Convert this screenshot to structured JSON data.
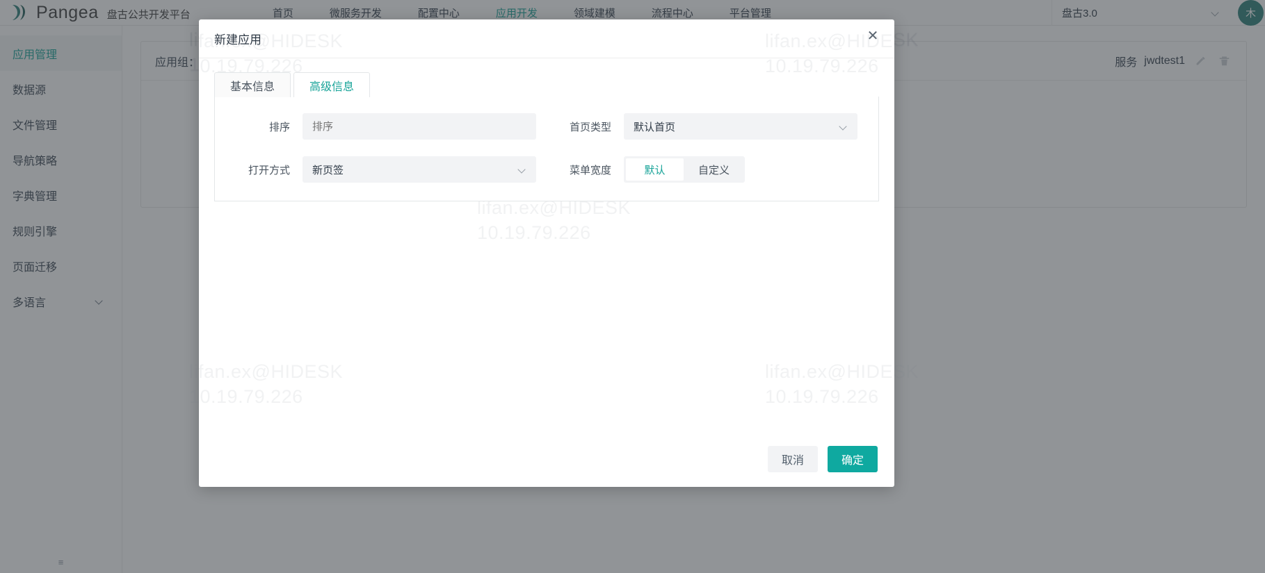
{
  "topbar": {
    "brand_name": "Pangea",
    "brand_subtitle": "盘古公共开发平台",
    "nav": [
      {
        "label": "首页",
        "active": false
      },
      {
        "label": "微服务开发",
        "active": false
      },
      {
        "label": "配置中心",
        "active": false
      },
      {
        "label": "应用开发",
        "active": true
      },
      {
        "label": "领域建模",
        "active": false
      },
      {
        "label": "流程中心",
        "active": false
      },
      {
        "label": "平台管理",
        "active": false
      }
    ],
    "env_select_value": "盘古3.0",
    "avatar_initial": "木"
  },
  "sidebar": {
    "items": [
      {
        "label": "应用管理",
        "active": true,
        "expandable": false
      },
      {
        "label": "数据源",
        "active": false,
        "expandable": false
      },
      {
        "label": "文件管理",
        "active": false,
        "expandable": false
      },
      {
        "label": "导航策略",
        "active": false,
        "expandable": false
      },
      {
        "label": "字典管理",
        "active": false,
        "expandable": false
      },
      {
        "label": "规则引擎",
        "active": false,
        "expandable": false
      },
      {
        "label": "页面迁移",
        "active": false,
        "expandable": false
      },
      {
        "label": "多语言",
        "active": false,
        "expandable": true
      }
    ],
    "collapse_label": "≡"
  },
  "content": {
    "app_group_label": "应用组：",
    "service_label": "服务",
    "service_value": "jwdtest1",
    "edit_icon": "pencil-icon",
    "delete_icon": "trash-icon"
  },
  "modal": {
    "title": "新建应用",
    "close_label": "✕",
    "tabs": [
      {
        "label": "基本信息",
        "active": false
      },
      {
        "label": "高级信息",
        "active": true
      }
    ],
    "fields": {
      "sort": {
        "label": "排序",
        "value": "",
        "placeholder": "排序"
      },
      "home_type": {
        "label": "首页类型",
        "value": "默认首页"
      },
      "open_mode": {
        "label": "打开方式",
        "value": "新页签"
      },
      "menu_width": {
        "label": "菜单宽度",
        "options": [
          "默认",
          "自定义"
        ],
        "selected": "默认"
      }
    },
    "footer": {
      "cancel_label": "取消",
      "confirm_label": "确定"
    }
  },
  "watermark": {
    "line1": "lifan.ex@HIDESK",
    "line2": "10.19.79.226"
  },
  "colors": {
    "accent": "#17a398",
    "primary_button": "#0fa9a0",
    "overlay": "#373c42",
    "text": "#2f3a46"
  }
}
